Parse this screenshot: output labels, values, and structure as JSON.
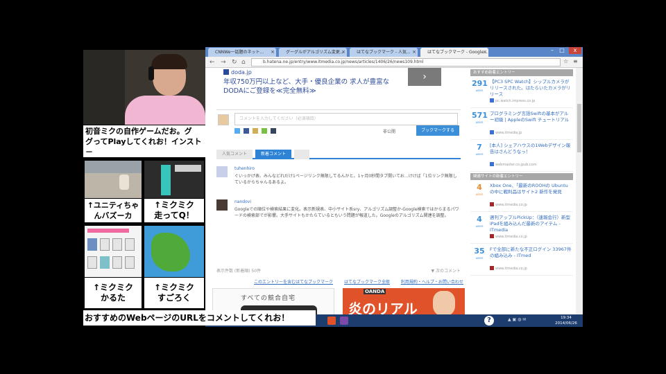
{
  "overlay": {
    "caption_top": "初音ミクの自作ゲームだお。グ\nグってPlayしてくれお！インスト－\nルやユーザ登録不要だお",
    "caption_bottom": "おすすめのWebページのURLをコメントしてくれお！",
    "thumbs": [
      {
        "label": "↑ユニティちゃ\nんバズーカ"
      },
      {
        "label": "↑ミクミク\n走ってQ！"
      },
      {
        "label": "↑ミクミク\nかるた"
      },
      {
        "label": "↑ミクミク\nすごろく"
      }
    ]
  },
  "browser": {
    "tabs": [
      {
        "label": "CNNWe一話題のネット..."
      },
      {
        "label": "グーグルがアルゴリズム変更..."
      },
      {
        "label": "はてなブックマーク - 人気..."
      },
      {
        "label": "はてなブックマーク - Google..."
      }
    ],
    "address": "b.hatena.ne.jp/entry/www.itmedia.co.jp/news/articles/1406/26/news109.html",
    "window_close": "x",
    "ad": {
      "brand": "doda.jp",
      "text": "年収750万円以上など、大手・優良企業の 求人が豊富なDODAにご登録を≪完全無料≫",
      "arrow": "›"
    },
    "comment": {
      "placeholder": "コメントを入力してください（必須項目）",
      "private_label": "非公開",
      "post_label": "ブックマークする"
    },
    "comment_tabs": [
      {
        "label": "人気コメント"
      },
      {
        "label": "新着コメント"
      },
      {
        "label": ""
      }
    ],
    "comments": [
      {
        "user": "tuhenhiro",
        "body": "ぐいっかげ表、みんなどれだけ1ページリンク無限してるんかと。1ヶ月0秒間タブ開いてお…けけば「1位リンク無限しているからちゃんるあるよ。"
      },
      {
        "user": "nandovi",
        "body": "Googleでの順位や検索結果に変化。表示新規表、中小サイト系sry、アルゴリズム調整か-Google検索ではからまるパワードの検索部でが影響。大手サイトもかたらているともいう問題が報道した。Googleのアルゴリズム関連を調整。"
      }
    ],
    "foot_left": "表示件数 (新着順) 50件",
    "foot_right": "▼ 次のコメント",
    "links": [
      {
        "label": "このエントリーを含むはてなブックマーク"
      },
      {
        "label": "はてなブックマーク全般"
      },
      {
        "label": "利用規約・ヘルプ・お問い合わせ"
      }
    ],
    "bottom_ad1": "すべての競合自宅",
    "bottom_ad2": {
      "brand": "OANDA",
      "big": "炎のリアル"
    },
    "sidebar": {
      "head1": "おすすめ新着エントリー",
      "head2": "関連サイトの新着エントリー",
      "items": [
        {
          "num": "291",
          "title": "【PC3 SPC Watch】シップルカメラがリリースされた。はたらいたカメラがリリース",
          "src": "pc.watch.impress.co.jp"
        },
        {
          "num": "571",
          "title": "プログラミング言語Swiftの基本がアルー初級 | AppleのSwift チュートリアル",
          "src": "www.itmedia.jp"
        },
        {
          "num": "7",
          "title": "[本人] シェアハウスの1Webデザイン報告はさんどうなっ！",
          "src": "webmaster.co.jpub.com"
        },
        {
          "num": "4",
          "title": "Xbox One、「最新のROOHの Ubuntuの中に戦利品はサイト2 新作を発見",
          "src": "www.itmedia.co.jp",
          "orange": true
        },
        {
          "num": "4",
          "title": "週刊アップルPickUp：（速報会行）新型iPadを組み込んだ最新のアイテム - ITmedia",
          "src": "www.itmedia.co.jp"
        },
        {
          "num": "35",
          "title": "Fで全部に新たな不正ログイン 33967件の組み込み - ITmed",
          "src": "www.itmedia.co.jp"
        }
      ]
    },
    "taskbar": {
      "help": "?",
      "clock_time": "19:34",
      "clock_date": "2014/06/26"
    }
  },
  "colors": {
    "accent": "#2f83d6",
    "tabbar": "#5a86c8",
    "taskbar": "#1d3d6e"
  }
}
